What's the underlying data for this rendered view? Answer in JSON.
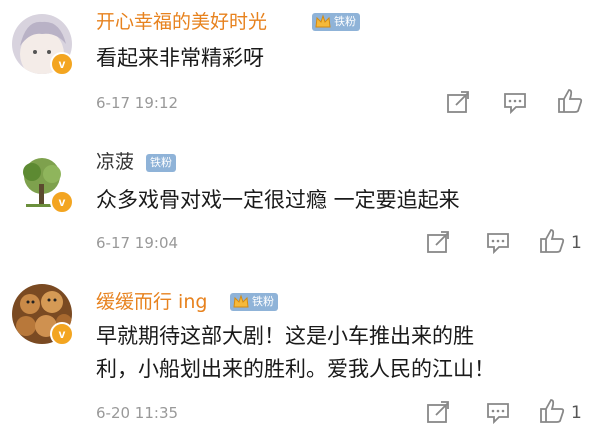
{
  "comments": [
    {
      "name": "开心幸福的美好时光",
      "badge": "铁粉",
      "text_lines": [
        "看起来非常精彩呀"
      ],
      "time": "6-17 19:12",
      "like_count": ""
    },
    {
      "name": "凉菠",
      "badge": "铁粉",
      "text_lines": [
        "众多戏骨对戏一定很过瘾 一定要追起来"
      ],
      "time": "6-17 19:04",
      "like_count": "1"
    },
    {
      "name": "缓缓而行 ing",
      "badge": "铁粉",
      "text_lines": [
        "早就期待这部大剧！这是小车推出来的胜",
        "利，小船划出来的胜利。爱我人民的江山！"
      ],
      "time": "6-20 11:35",
      "like_count": "1"
    }
  ],
  "verified_mark": "v",
  "icons": [
    "share-icon",
    "comment-icon",
    "like-icon",
    "crown-icon"
  ],
  "colors": {
    "name_orange": "#e7821e",
    "badge_blue": "#8fb3d8",
    "verified_gold": "#f3a521"
  }
}
